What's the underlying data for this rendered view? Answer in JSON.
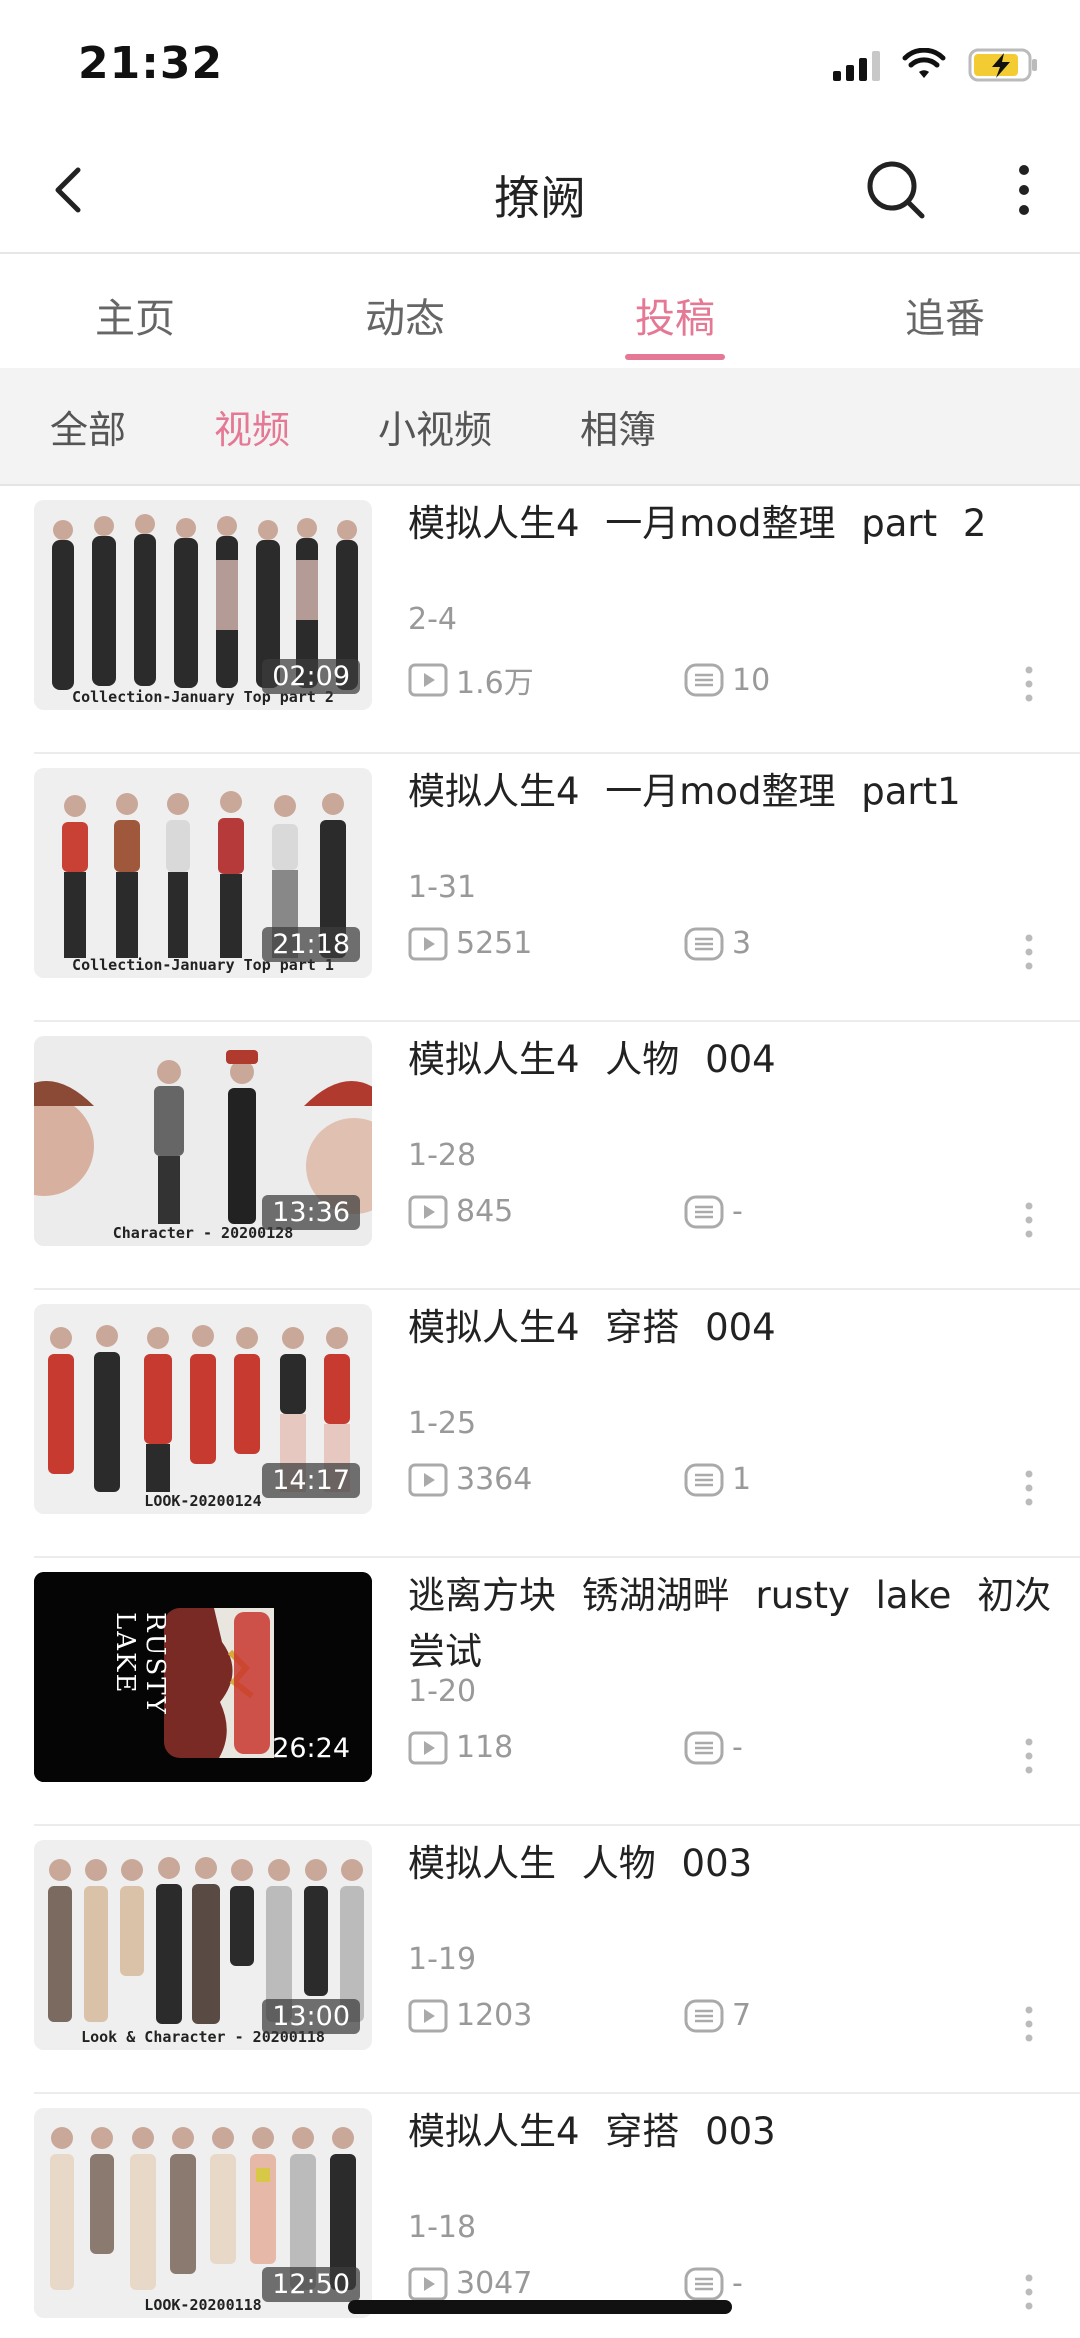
{
  "status_bar": {
    "time": "21:32"
  },
  "nav": {
    "title": "撩阙"
  },
  "tabs": [
    {
      "label": "主页",
      "active": false
    },
    {
      "label": "动态",
      "active": false
    },
    {
      "label": "投稿",
      "active": true
    },
    {
      "label": "追番",
      "active": false
    }
  ],
  "subtabs": [
    {
      "label": "全部",
      "active": false
    },
    {
      "label": "视频",
      "active": true
    },
    {
      "label": "小视频",
      "active": false
    },
    {
      "label": "相簿",
      "active": false
    }
  ],
  "accent_color": "#e57894",
  "videos": [
    {
      "title": "模拟人生4 一月mod整理 part 2",
      "date": "2-4",
      "plays": "1.6万",
      "comments": "10",
      "duration": "02:09",
      "thumb_caption": "Collection-January Top part 2"
    },
    {
      "title": "模拟人生4 一月mod整理 part1",
      "date": "1-31",
      "plays": "5251",
      "comments": "3",
      "duration": "21:18",
      "thumb_caption": "Collection-January Top part 1"
    },
    {
      "title": "模拟人生4 人物 004",
      "date": "1-28",
      "plays": "845",
      "comments": "-",
      "duration": "13:36",
      "thumb_caption": "Character - 20200128"
    },
    {
      "title": "模拟人生4 穿搭 004",
      "date": "1-25",
      "plays": "3364",
      "comments": "1",
      "duration": "14:17",
      "thumb_caption": "LOOK-20200124"
    },
    {
      "title": "逃离方块 锈湖湖畔 rusty lake 初次尝试",
      "date": "1-20",
      "plays": "118",
      "comments": "-",
      "duration": "26:24",
      "thumb_caption": "RUSTY LAKE"
    },
    {
      "title": "模拟人生 人物 003",
      "date": "1-19",
      "plays": "1203",
      "comments": "7",
      "duration": "13:00",
      "thumb_caption": "Look & Character - 20200118"
    },
    {
      "title": "模拟人生4 穿搭 003",
      "date": "1-18",
      "plays": "3047",
      "comments": "-",
      "duration": "12:50",
      "thumb_caption": "LOOK-20200118"
    }
  ]
}
